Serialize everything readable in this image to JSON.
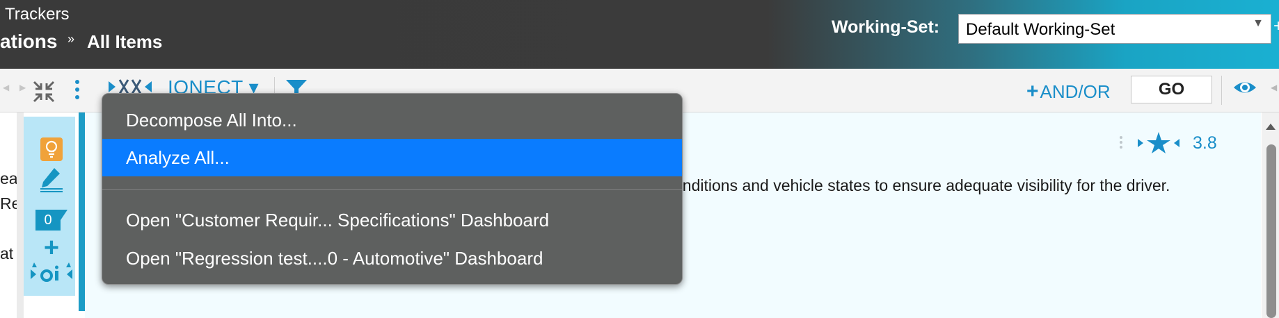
{
  "header": {
    "trackers_label": "Trackers",
    "breadcrumb_parent": "ations",
    "breadcrumb_separator": "»",
    "breadcrumb_current": "All Items",
    "working_set_label": "Working-Set:",
    "working_set_value": "Default Working-Set",
    "working_set_caret": "▼"
  },
  "toolbar": {
    "connect_label": "IONECT ▾",
    "andor_plus": "+",
    "andor_label": "AND/OR",
    "go_label": "GO"
  },
  "item": {
    "count": "0",
    "rating": "3.8",
    "description": "onditions and vehicle states to ensure adequate visibility for the driver.",
    "left_fragments": [
      "ea",
      "Re",
      "at"
    ]
  },
  "menu": {
    "items": [
      "Decompose All Into...",
      "Analyze All...",
      "Open \"Customer Requir... Specifications\" Dashboard",
      "Open \"Regression test....0 - Automotive\" Dashboard"
    ],
    "active_index": 1
  },
  "colors": {
    "accent_blue": "#1a8ec9",
    "menu_bg": "#5e605f",
    "menu_active": "#0a7cff",
    "icon_panel": "#b9e6f7",
    "item_bg": "#f2fcff",
    "bulb_orange": "#f0a23a"
  },
  "icons": [
    "collapse-icon",
    "kebab-menu-icon",
    "connect-icon",
    "filter-icon",
    "eye-icon",
    "lightbulb-icon",
    "edit-icon",
    "plus-icon",
    "ai-icon",
    "rating-star-icon"
  ]
}
